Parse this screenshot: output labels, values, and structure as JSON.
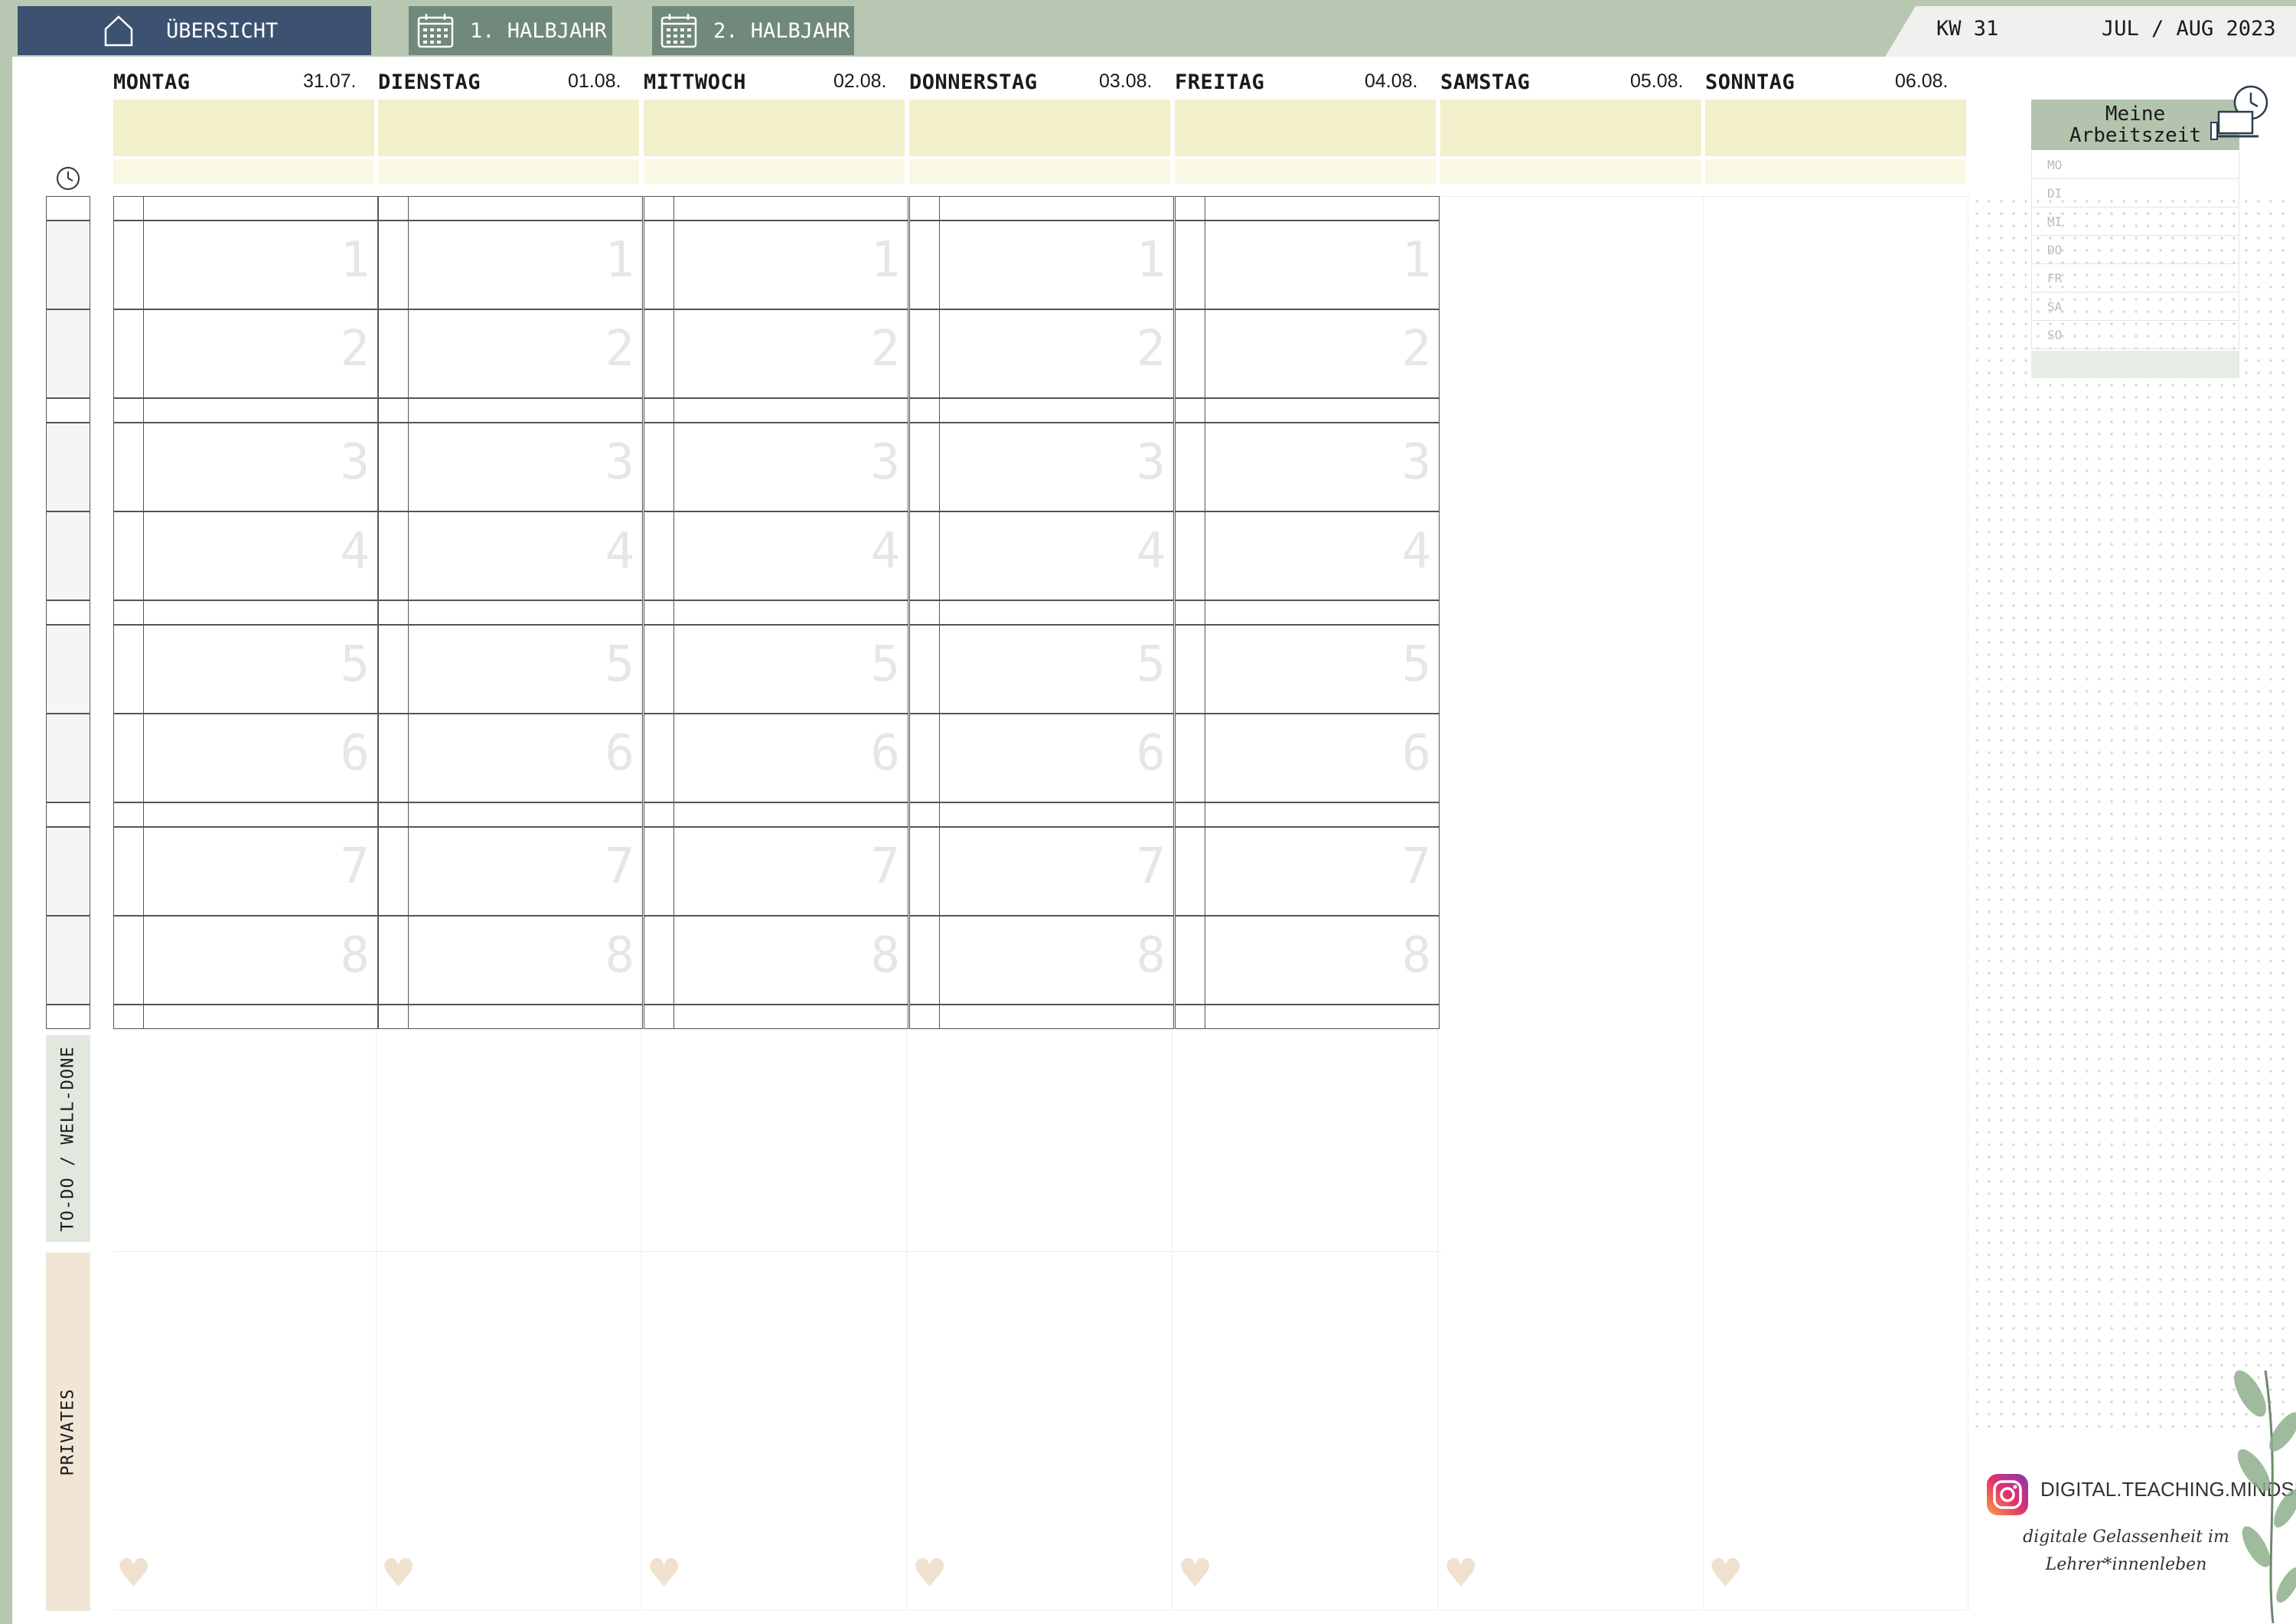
{
  "nav": {
    "home": "ÜBERSICHT",
    "half1": "1. HALBJAHR",
    "half2": "2. HALBJAHR"
  },
  "header": {
    "week": "KW 31",
    "month": "JUL / AUG 2023"
  },
  "days": [
    {
      "name": "MONTAG",
      "date": "31.07."
    },
    {
      "name": "DIENSTAG",
      "date": "01.08."
    },
    {
      "name": "MITTWOCH",
      "date": "02.08."
    },
    {
      "name": "DONNERSTAG",
      "date": "03.08."
    },
    {
      "name": "FREITAG",
      "date": "04.08."
    },
    {
      "name": "SAMSTAG",
      "date": "05.08."
    },
    {
      "name": "SONNTAG",
      "date": "06.08."
    }
  ],
  "periods": [
    "1",
    "2",
    "3",
    "4",
    "5",
    "6",
    "7",
    "8"
  ],
  "sections": {
    "todo": "TO-DO / WELL-DONE",
    "privates": "PRIVATES"
  },
  "worktime": {
    "title_line1": "Meine",
    "title_line2": "Arbeitszeit",
    "days": [
      "MO",
      "DI",
      "MI",
      "DO",
      "FR",
      "SA",
      "SO"
    ]
  },
  "footer": {
    "instagram": "DIGITAL.TEACHING.MINDSET",
    "tagline_line1": "digitale Gelassenheit im",
    "tagline_line2": "Lehrer*innenleben"
  },
  "colors": {
    "navy": "#3c5270",
    "sage": "#70897b",
    "background": "#b8c7b1",
    "yellow": "#f1f0ca",
    "todo_label": "#e2e8de",
    "privates_label": "#f1e5d5",
    "heart": "#f0e1cf"
  },
  "icons": [
    "home-icon",
    "calendar-icon",
    "clock-icon",
    "laptop-clock-icon",
    "instagram-icon",
    "heart-icon",
    "leaf-decoration"
  ]
}
